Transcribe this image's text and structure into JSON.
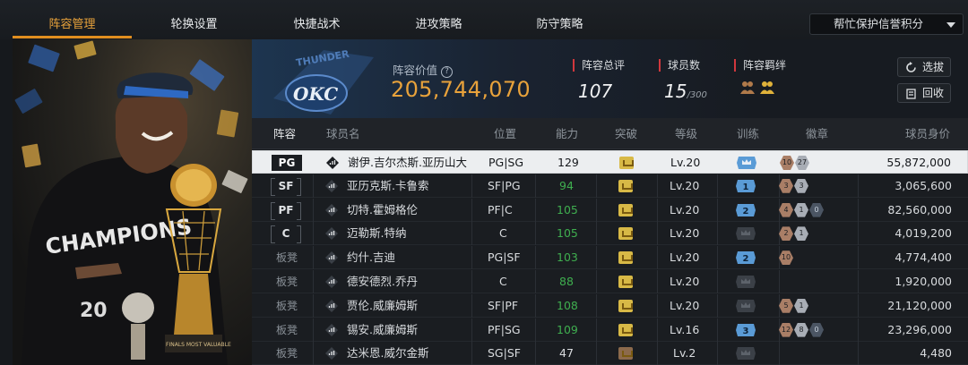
{
  "tabs": [
    {
      "label": "阵容管理",
      "active": true
    },
    {
      "label": "轮换设置",
      "active": false
    },
    {
      "label": "快捷战术",
      "active": false
    },
    {
      "label": "进攻策略",
      "active": false
    },
    {
      "label": "防守策略",
      "active": false
    }
  ],
  "dropdown": {
    "label": "帮忙保护信誉积分"
  },
  "hero": {
    "jersey_text": "CHAMPIONS",
    "number": "20",
    "trophy_text": "FINALS MOST VALUABLE"
  },
  "team": {
    "logo_text": "OKC",
    "logo_city": "THUNDER"
  },
  "lineup_value": {
    "label": "阵容价值",
    "help_icon": "?",
    "value": "205,744,070"
  },
  "stats": {
    "rating_label": "阵容总评",
    "rating": "107",
    "players_label": "球员数",
    "players": "15",
    "players_max": "/300",
    "bond_label": "阵容羁绊"
  },
  "buttons": {
    "select": "选拔",
    "recycle": "回收"
  },
  "columns": [
    "阵容",
    "球员名",
    "位置",
    "能力",
    "突破",
    "等级",
    "训练",
    "徽章",
    "球员身价"
  ],
  "rows": [
    {
      "slot": "PG",
      "name": "谢伊.吉尔杰斯.亚历山大",
      "position": "PG|SG",
      "ability": "129",
      "level": "Lv.20",
      "train": "",
      "badges": [
        {
          "t": "b",
          "n": "10"
        },
        {
          "t": "s",
          "n": "27"
        }
      ],
      "value": "55,872,000",
      "selected": true,
      "bench": false
    },
    {
      "slot": "SF",
      "name": "亚历克斯.卡鲁索",
      "position": "SF|PG",
      "ability": "94",
      "level": "Lv.20",
      "train": "1",
      "badges": [
        {
          "t": "b",
          "n": "3"
        },
        {
          "t": "s",
          "n": "3"
        }
      ],
      "value": "3,065,600",
      "selected": false,
      "bench": false
    },
    {
      "slot": "PF",
      "name": "切特.霍姆格伦",
      "position": "PF|C",
      "ability": "105",
      "level": "Lv.20",
      "train": "2",
      "badges": [
        {
          "t": "b",
          "n": "4"
        },
        {
          "t": "s",
          "n": "1"
        },
        {
          "t": "d",
          "n": "0"
        }
      ],
      "value": "82,560,000",
      "selected": false,
      "bench": false
    },
    {
      "slot": "C",
      "name": "迈勒斯.特纳",
      "position": "C",
      "ability": "105",
      "level": "Lv.20",
      "train": "",
      "badges": [
        {
          "t": "b",
          "n": "2"
        },
        {
          "t": "s",
          "n": "1"
        }
      ],
      "value": "4,019,200",
      "selected": false,
      "bench": false
    },
    {
      "slot": "板凳",
      "name": "约什.吉迪",
      "position": "PG|SF",
      "ability": "103",
      "level": "Lv.20",
      "train": "2",
      "badges": [
        {
          "t": "b",
          "n": "10"
        }
      ],
      "value": "4,774,400",
      "selected": false,
      "bench": true
    },
    {
      "slot": "板凳",
      "name": "德安德烈.乔丹",
      "position": "C",
      "ability": "88",
      "level": "Lv.20",
      "train": "",
      "badges": [],
      "value": "1,920,000",
      "selected": false,
      "bench": true
    },
    {
      "slot": "板凳",
      "name": "贾伦.威廉姆斯",
      "position": "SF|PF",
      "ability": "108",
      "level": "Lv.20",
      "train": "",
      "badges": [
        {
          "t": "b",
          "n": "5"
        },
        {
          "t": "s",
          "n": "1"
        }
      ],
      "value": "21,120,000",
      "selected": false,
      "bench": true
    },
    {
      "slot": "板凳",
      "name": "锡安.威廉姆斯",
      "position": "PF|SG",
      "ability": "109",
      "level": "Lv.16",
      "train": "3",
      "badges": [
        {
          "t": "b",
          "n": "12"
        },
        {
          "t": "s",
          "n": "8"
        },
        {
          "t": "d",
          "n": "0"
        }
      ],
      "value": "23,296,000",
      "selected": false,
      "bench": true
    },
    {
      "slot": "板凳",
      "name": "达米恩.威尔金斯",
      "position": "SG|SF",
      "ability": "47",
      "level": "Lv.2",
      "train": "",
      "badges": [],
      "value": "4,480",
      "selected": false,
      "bench": true
    }
  ],
  "colors": {
    "accent": "#e8a23b",
    "green": "#3fae4f",
    "red": "#d0373d",
    "train_blue": "#5a9bd6"
  }
}
